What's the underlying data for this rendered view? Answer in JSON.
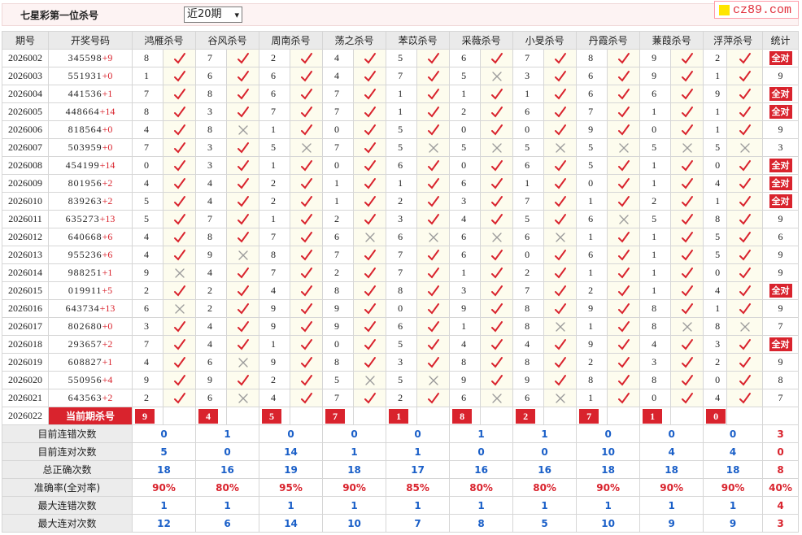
{
  "header": {
    "title": "七星彩第一位杀号",
    "period_select": "近20期",
    "logo_text": "cz89.com"
  },
  "columns": {
    "period": "期号",
    "draw": "开奖号码",
    "experts": [
      "鸿雁杀号",
      "谷风杀号",
      "周南杀号",
      "荡之杀号",
      "苯苡杀号",
      "采薇杀号",
      "小旻杀号",
      "丹霞杀号",
      "蒹葭杀号",
      "浮萍杀号"
    ],
    "total": "统计"
  },
  "rows": [
    {
      "period": "2026002",
      "digits": "345598",
      "add": "+9",
      "picks": [
        [
          8,
          1
        ],
        [
          7,
          1
        ],
        [
          2,
          1
        ],
        [
          4,
          1
        ],
        [
          5,
          1
        ],
        [
          6,
          1
        ],
        [
          7,
          1
        ],
        [
          8,
          1
        ],
        [
          9,
          1
        ],
        [
          2,
          1
        ]
      ],
      "total": "全对"
    },
    {
      "period": "2026003",
      "digits": "551931",
      "add": "+0",
      "picks": [
        [
          1,
          1
        ],
        [
          6,
          1
        ],
        [
          6,
          1
        ],
        [
          4,
          1
        ],
        [
          7,
          1
        ],
        [
          5,
          0
        ],
        [
          3,
          1
        ],
        [
          6,
          1
        ],
        [
          9,
          1
        ],
        [
          1,
          1
        ]
      ],
      "total": "9"
    },
    {
      "period": "2026004",
      "digits": "441536",
      "add": "+1",
      "picks": [
        [
          7,
          1
        ],
        [
          8,
          1
        ],
        [
          6,
          1
        ],
        [
          7,
          1
        ],
        [
          1,
          1
        ],
        [
          1,
          1
        ],
        [
          1,
          1
        ],
        [
          6,
          1
        ],
        [
          6,
          1
        ],
        [
          9,
          1
        ]
      ],
      "total": "全对"
    },
    {
      "period": "2026005",
      "digits": "448664",
      "add": "+14",
      "picks": [
        [
          8,
          1
        ],
        [
          3,
          1
        ],
        [
          7,
          1
        ],
        [
          7,
          1
        ],
        [
          1,
          1
        ],
        [
          2,
          1
        ],
        [
          6,
          1
        ],
        [
          7,
          1
        ],
        [
          1,
          1
        ],
        [
          1,
          1
        ]
      ],
      "total": "全对"
    },
    {
      "period": "2026006",
      "digits": "818564",
      "add": "+0",
      "picks": [
        [
          4,
          1
        ],
        [
          8,
          0
        ],
        [
          1,
          1
        ],
        [
          0,
          1
        ],
        [
          5,
          1
        ],
        [
          0,
          1
        ],
        [
          0,
          1
        ],
        [
          9,
          1
        ],
        [
          0,
          1
        ],
        [
          1,
          1
        ]
      ],
      "total": "9"
    },
    {
      "period": "2026007",
      "digits": "503959",
      "add": "+0",
      "picks": [
        [
          7,
          1
        ],
        [
          3,
          1
        ],
        [
          5,
          0
        ],
        [
          7,
          1
        ],
        [
          5,
          0
        ],
        [
          5,
          0
        ],
        [
          5,
          0
        ],
        [
          5,
          0
        ],
        [
          5,
          0
        ],
        [
          5,
          0
        ]
      ],
      "total": "3"
    },
    {
      "period": "2026008",
      "digits": "454199",
      "add": "+14",
      "picks": [
        [
          0,
          1
        ],
        [
          3,
          1
        ],
        [
          1,
          1
        ],
        [
          0,
          1
        ],
        [
          6,
          1
        ],
        [
          0,
          1
        ],
        [
          6,
          1
        ],
        [
          5,
          1
        ],
        [
          1,
          1
        ],
        [
          0,
          1
        ]
      ],
      "total": "全对"
    },
    {
      "period": "2026009",
      "digits": "801956",
      "add": "+2",
      "picks": [
        [
          4,
          1
        ],
        [
          4,
          1
        ],
        [
          2,
          1
        ],
        [
          1,
          1
        ],
        [
          1,
          1
        ],
        [
          6,
          1
        ],
        [
          1,
          1
        ],
        [
          0,
          1
        ],
        [
          1,
          1
        ],
        [
          4,
          1
        ]
      ],
      "total": "全对"
    },
    {
      "period": "2026010",
      "digits": "839263",
      "add": "+2",
      "picks": [
        [
          5,
          1
        ],
        [
          4,
          1
        ],
        [
          2,
          1
        ],
        [
          1,
          1
        ],
        [
          2,
          1
        ],
        [
          3,
          1
        ],
        [
          7,
          1
        ],
        [
          1,
          1
        ],
        [
          2,
          1
        ],
        [
          1,
          1
        ]
      ],
      "total": "全对"
    },
    {
      "period": "2026011",
      "digits": "635273",
      "add": "+13",
      "picks": [
        [
          5,
          1
        ],
        [
          7,
          1
        ],
        [
          1,
          1
        ],
        [
          2,
          1
        ],
        [
          3,
          1
        ],
        [
          4,
          1
        ],
        [
          5,
          1
        ],
        [
          6,
          0
        ],
        [
          5,
          1
        ],
        [
          8,
          1
        ]
      ],
      "total": "9"
    },
    {
      "period": "2026012",
      "digits": "640668",
      "add": "+6",
      "picks": [
        [
          4,
          1
        ],
        [
          8,
          1
        ],
        [
          7,
          1
        ],
        [
          6,
          0
        ],
        [
          6,
          0
        ],
        [
          6,
          0
        ],
        [
          6,
          0
        ],
        [
          1,
          1
        ],
        [
          1,
          1
        ],
        [
          5,
          1
        ]
      ],
      "total": "6"
    },
    {
      "period": "2026013",
      "digits": "955236",
      "add": "+6",
      "picks": [
        [
          4,
          1
        ],
        [
          9,
          0
        ],
        [
          8,
          1
        ],
        [
          7,
          1
        ],
        [
          7,
          1
        ],
        [
          6,
          1
        ],
        [
          0,
          1
        ],
        [
          6,
          1
        ],
        [
          1,
          1
        ],
        [
          5,
          1
        ]
      ],
      "total": "9"
    },
    {
      "period": "2026014",
      "digits": "988251",
      "add": "+1",
      "picks": [
        [
          9,
          0
        ],
        [
          4,
          1
        ],
        [
          7,
          1
        ],
        [
          2,
          1
        ],
        [
          7,
          1
        ],
        [
          1,
          1
        ],
        [
          2,
          1
        ],
        [
          1,
          1
        ],
        [
          1,
          1
        ],
        [
          0,
          1
        ]
      ],
      "total": "9"
    },
    {
      "period": "2026015",
      "digits": "019911",
      "add": "+5",
      "picks": [
        [
          2,
          1
        ],
        [
          2,
          1
        ],
        [
          4,
          1
        ],
        [
          8,
          1
        ],
        [
          8,
          1
        ],
        [
          3,
          1
        ],
        [
          7,
          1
        ],
        [
          2,
          1
        ],
        [
          1,
          1
        ],
        [
          4,
          1
        ]
      ],
      "total": "全对"
    },
    {
      "period": "2026016",
      "digits": "643734",
      "add": "+13",
      "picks": [
        [
          6,
          0
        ],
        [
          2,
          1
        ],
        [
          9,
          1
        ],
        [
          9,
          1
        ],
        [
          0,
          1
        ],
        [
          9,
          1
        ],
        [
          8,
          1
        ],
        [
          9,
          1
        ],
        [
          8,
          1
        ],
        [
          1,
          1
        ]
      ],
      "total": "9"
    },
    {
      "period": "2026017",
      "digits": "802680",
      "add": "+0",
      "picks": [
        [
          3,
          1
        ],
        [
          4,
          1
        ],
        [
          9,
          1
        ],
        [
          9,
          1
        ],
        [
          6,
          1
        ],
        [
          1,
          1
        ],
        [
          8,
          0
        ],
        [
          1,
          1
        ],
        [
          8,
          0
        ],
        [
          8,
          0
        ]
      ],
      "total": "7"
    },
    {
      "period": "2026018",
      "digits": "293657",
      "add": "+2",
      "picks": [
        [
          7,
          1
        ],
        [
          4,
          1
        ],
        [
          1,
          1
        ],
        [
          0,
          1
        ],
        [
          5,
          1
        ],
        [
          4,
          1
        ],
        [
          4,
          1
        ],
        [
          9,
          1
        ],
        [
          4,
          1
        ],
        [
          3,
          1
        ]
      ],
      "total": "全对"
    },
    {
      "period": "2026019",
      "digits": "608827",
      "add": "+1",
      "picks": [
        [
          4,
          1
        ],
        [
          6,
          0
        ],
        [
          9,
          1
        ],
        [
          8,
          1
        ],
        [
          3,
          1
        ],
        [
          8,
          1
        ],
        [
          8,
          1
        ],
        [
          2,
          1
        ],
        [
          3,
          1
        ],
        [
          2,
          1
        ]
      ],
      "total": "9"
    },
    {
      "period": "2026020",
      "digits": "550956",
      "add": "+4",
      "picks": [
        [
          9,
          1
        ],
        [
          9,
          1
        ],
        [
          2,
          1
        ],
        [
          5,
          0
        ],
        [
          5,
          0
        ],
        [
          9,
          1
        ],
        [
          9,
          1
        ],
        [
          8,
          1
        ],
        [
          8,
          1
        ],
        [
          0,
          1
        ]
      ],
      "total": "8"
    },
    {
      "period": "2026021",
      "digits": "643563",
      "add": "+2",
      "picks": [
        [
          2,
          1
        ],
        [
          6,
          0
        ],
        [
          4,
          1
        ],
        [
          7,
          1
        ],
        [
          2,
          1
        ],
        [
          6,
          0
        ],
        [
          6,
          0
        ],
        [
          1,
          1
        ],
        [
          0,
          1
        ],
        [
          4,
          1
        ]
      ],
      "total": "7"
    }
  ],
  "current": {
    "period": "2026022",
    "label": "当前期杀号",
    "picks": [
      "9",
      "4",
      "5",
      "7",
      "1",
      "8",
      "2",
      "7",
      "1",
      "0"
    ]
  },
  "stats": [
    {
      "label": "目前连错次数",
      "values": [
        "0",
        "1",
        "0",
        "0",
        "0",
        "1",
        "1",
        "0",
        "0",
        "0"
      ],
      "total": "3",
      "red": false
    },
    {
      "label": "目前连对次数",
      "values": [
        "5",
        "0",
        "14",
        "1",
        "1",
        "0",
        "0",
        "10",
        "4",
        "4"
      ],
      "total": "0",
      "red": false
    },
    {
      "label": "总正确次数",
      "values": [
        "18",
        "16",
        "19",
        "18",
        "17",
        "16",
        "16",
        "18",
        "18",
        "18"
      ],
      "total": "8",
      "red": false
    },
    {
      "label": "准确率(全对率)",
      "values": [
        "90%",
        "80%",
        "95%",
        "90%",
        "85%",
        "80%",
        "80%",
        "90%",
        "90%",
        "90%"
      ],
      "total": "40%",
      "red": true
    },
    {
      "label": "最大连错次数",
      "values": [
        "1",
        "1",
        "1",
        "1",
        "1",
        "1",
        "1",
        "1",
        "1",
        "1"
      ],
      "total": "4",
      "red": false
    },
    {
      "label": "最大连对次数",
      "values": [
        "12",
        "6",
        "14",
        "10",
        "7",
        "8",
        "5",
        "10",
        "9",
        "9"
      ],
      "total": "3",
      "red": false
    }
  ],
  "colors": {
    "accent": "#d9232d",
    "stat_blue": "#1a5fc8",
    "mark_bg": "#fdfcee"
  },
  "icons": {
    "correct": "check-icon",
    "wrong": "cross-icon"
  }
}
